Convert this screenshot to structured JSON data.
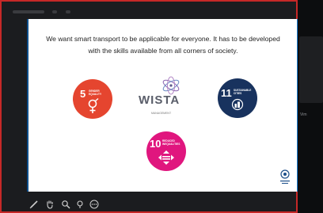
{
  "colors": {
    "frame_border": "#c62828",
    "sdg5": "#e5452f",
    "sdg11": "#18325e",
    "sdg10": "#e0167e",
    "slide_accent": "#0e4f8b"
  },
  "slide": {
    "text": "We want smart transport to be applicable for everyone. It has to be developed with the skills available from all corners of society.",
    "sdg_goals": [
      {
        "number": "5",
        "label": "GENDER EQUALITY",
        "icon": "gender-equality-icon"
      },
      {
        "number": "11",
        "label": "SUSTAINABLE CITIES",
        "icon": "city-icon"
      },
      {
        "number": "10",
        "label": "REDUCED INEQUALITIES",
        "icon": "equality-arrows-icon"
      }
    ],
    "logo": {
      "name": "WISTA",
      "subtitle": "MANAGEMENT"
    }
  },
  "side_panel": {
    "label": "Vim"
  },
  "toolbar": {
    "tools": [
      "pen-icon",
      "hand-icon",
      "zoom-icon",
      "pointer-icon",
      "more-icon"
    ]
  }
}
